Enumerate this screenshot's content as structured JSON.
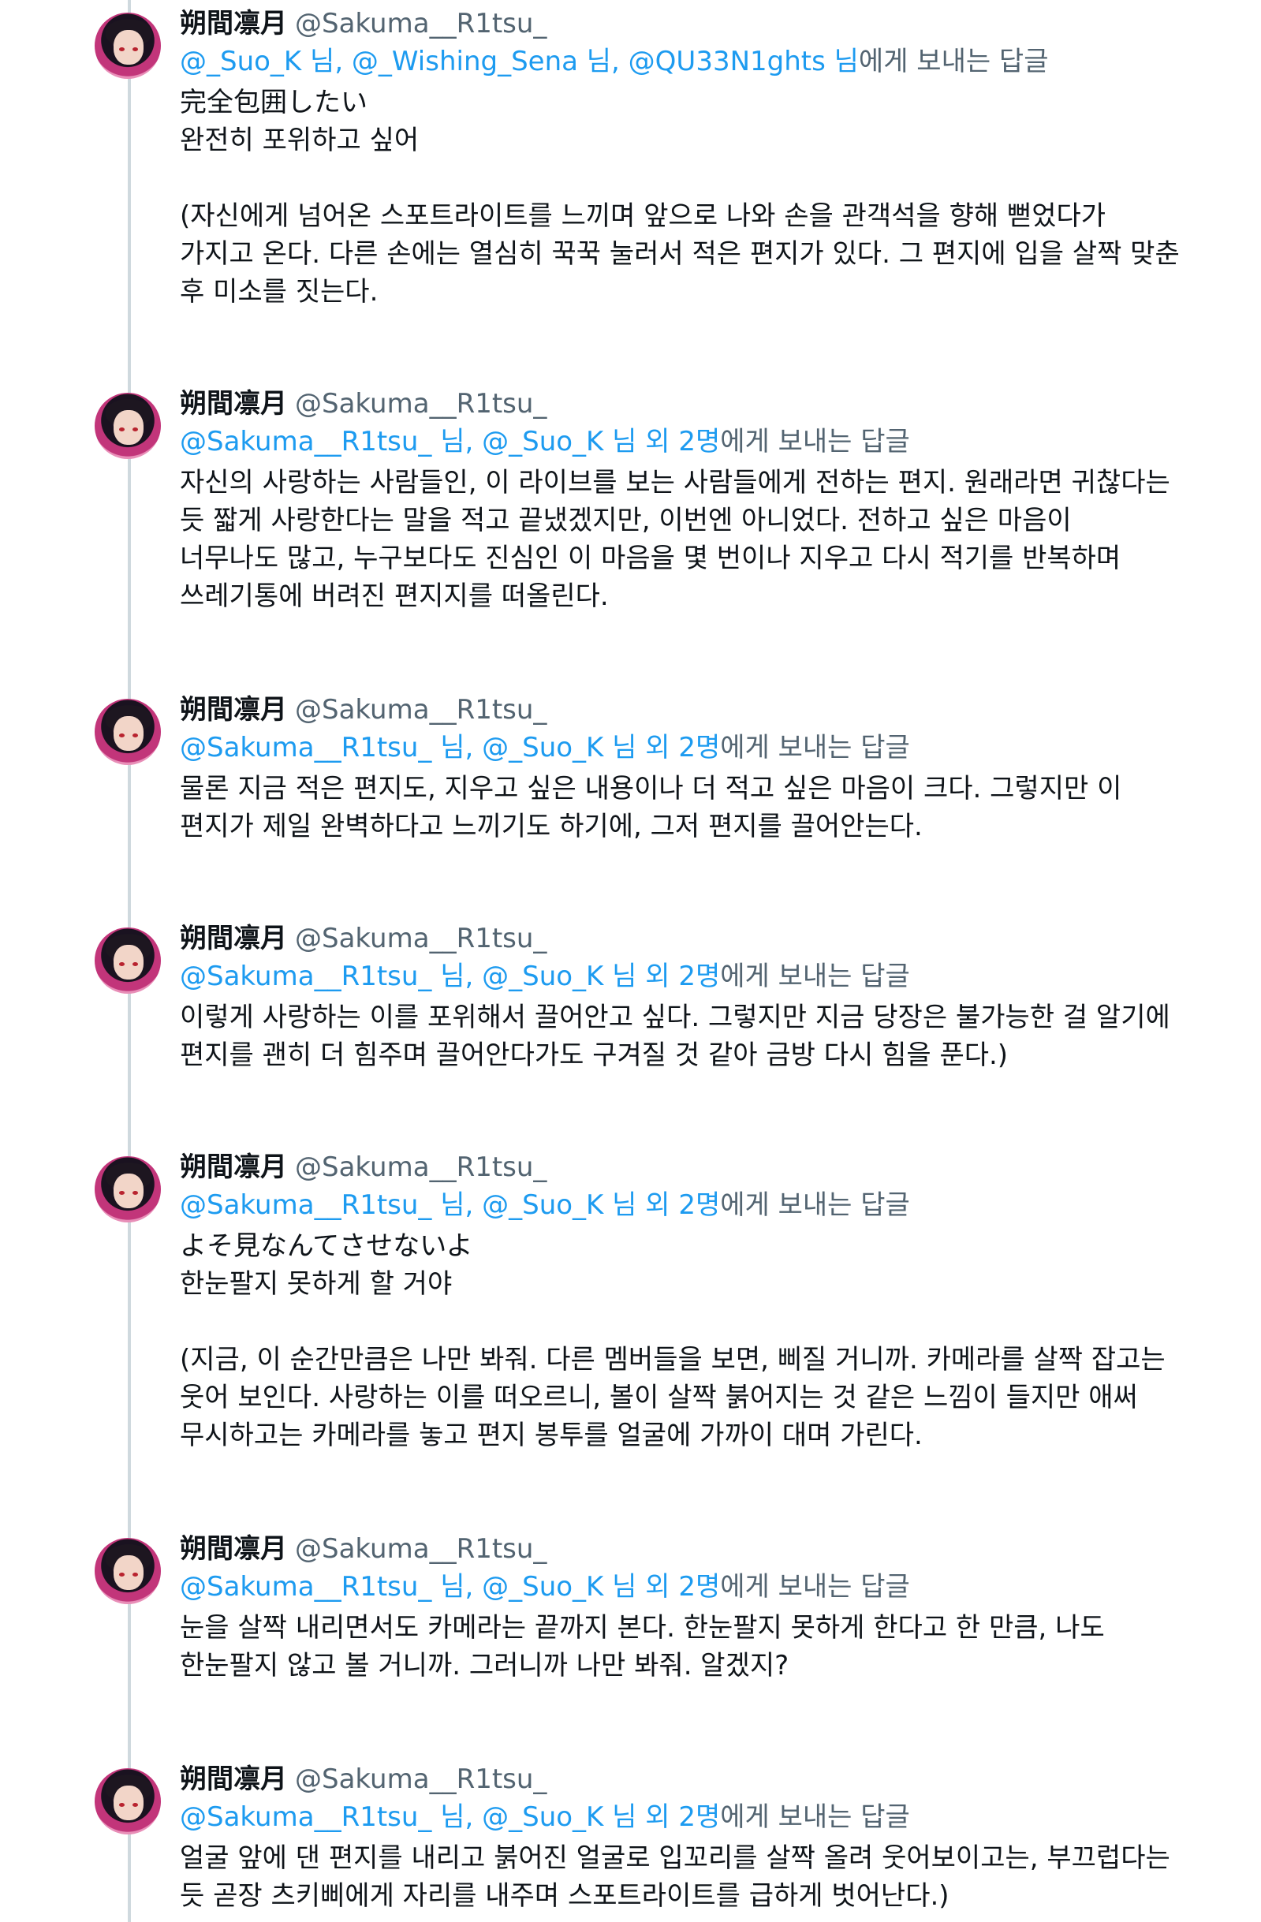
{
  "author": {
    "name": "朔間凛月",
    "handle": "@Sakuma__R1tsu_"
  },
  "reply_suffix": "에게 보내는 답글",
  "tweets": [
    {
      "mentions": "@_Suo_K 님, @_Wishing_Sena 님, @QU33N1ghts 님",
      "text": "完全包囲したい\n완전히 포위하고 싶어\n\n(자신에게 넘어온 스포트라이트를 느끼며 앞으로 나와 손을 관객석을 향해 뻗었다가\n가지고 온다. 다른 손에는 열심히 꾹꾹 눌러서 적은 편지가 있다. 그 편지에 입을 살짝 맞춘\n후 미소를 짓는다."
    },
    {
      "mentions": "@Sakuma__R1tsu_ 님, @_Suo_K 님 외 2명",
      "text": "자신의 사랑하는 사람들인, 이 라이브를 보는 사람들에게 전하는 편지. 원래라면 귀찮다는\n듯 짧게 사랑한다는 말을 적고 끝냈겠지만, 이번엔 아니었다. 전하고 싶은 마음이\n너무나도 많고, 누구보다도 진심인 이 마음을 몇 번이나 지우고 다시 적기를 반복하며\n쓰레기통에 버려진 편지지를 떠올린다."
    },
    {
      "mentions": "@Sakuma__R1tsu_ 님, @_Suo_K 님 외 2명",
      "text": "물론 지금 적은 편지도, 지우고 싶은 내용이나 더 적고 싶은 마음이 크다. 그렇지만 이\n편지가 제일 완벽하다고 느끼기도 하기에, 그저 편지를 끌어안는다."
    },
    {
      "mentions": "@Sakuma__R1tsu_ 님, @_Suo_K 님 외 2명",
      "text": "이렇게 사랑하는 이를 포위해서 끌어안고 싶다. 그렇지만 지금 당장은 불가능한 걸 알기에\n편지를 괜히 더 힘주며 끌어안다가도 구겨질 것 같아 금방 다시 힘을 푼다.)"
    },
    {
      "mentions": "@Sakuma__R1tsu_ 님, @_Suo_K 님 외 2명",
      "text": "よそ見なんてさせないよ\n한눈팔지 못하게 할 거야\n\n(지금, 이 순간만큼은 나만 봐줘. 다른 멤버들을 보면, 삐질 거니까. 카메라를 살짝 잡고는\n웃어 보인다. 사랑하는 이를 떠오르니, 볼이 살짝 붉어지는 것 같은 느낌이 들지만 애써\n무시하고는 카메라를 놓고 편지 봉투를 얼굴에 가까이 대며 가린다."
    },
    {
      "mentions": "@Sakuma__R1tsu_ 님, @_Suo_K 님 외 2명",
      "text": "눈을 살짝 내리면서도 카메라는 끝까지 본다. 한눈팔지 못하게 한다고 한 만큼, 나도\n한눈팔지 않고 볼 거니까. 그러니까 나만 봐줘. 알겠지?"
    },
    {
      "mentions": "@Sakuma__R1tsu_ 님, @_Suo_K 님 외 2명",
      "text": "얼굴 앞에 댄 편지를 내리고 붉어진 얼굴로 입꼬리를 살짝 올려 웃어보이고는, 부끄럽다는\n듯 곧장 츠키삐에게 자리를 내주며 스포트라이트를 급하게 벗어난다.)"
    }
  ]
}
